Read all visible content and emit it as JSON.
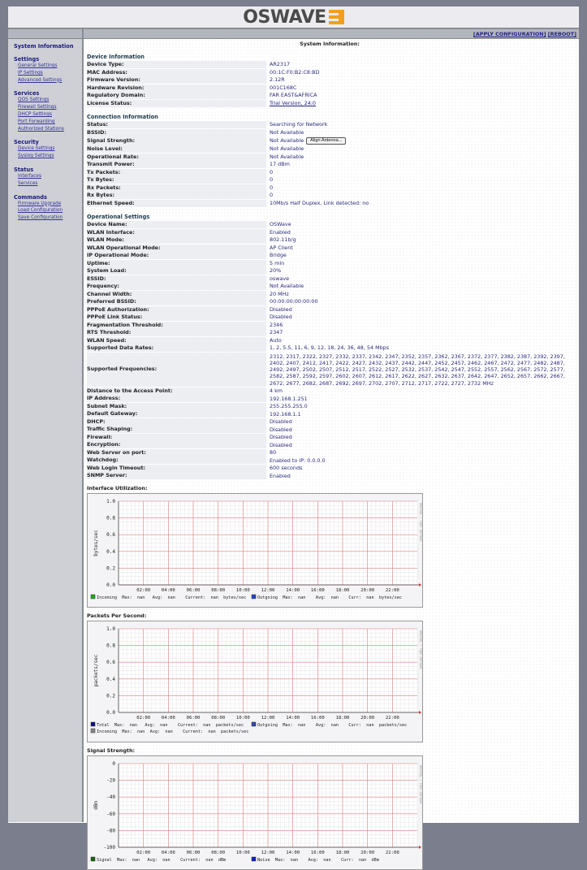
{
  "header": {
    "logo_text": "OSWAVE"
  },
  "topbar": {
    "apply": "[APPLY CONFIGURATION]",
    "reboot": "[REBOOT]"
  },
  "sidebar": {
    "system_info": "System Information",
    "sections": [
      {
        "title": "Settings",
        "links": [
          "General Settings",
          "IP Settings",
          "Advanced Settings"
        ]
      },
      {
        "title": "Services",
        "links": [
          "QOS Settings",
          "Firewall Settings",
          "DHCP Settings",
          "Port Forwarding",
          "Authorized Stations"
        ]
      },
      {
        "title": "Security",
        "links": [
          "Device Settings",
          "Syslog Settings"
        ]
      },
      {
        "title": "Status",
        "links": [
          "Interfaces",
          "Services"
        ]
      },
      {
        "title": "Commands",
        "links": [
          "Firmware Upgrade",
          "Load Configuration",
          "Save Configuration"
        ]
      }
    ]
  },
  "page_title": "System Information:",
  "device_info": {
    "title": "Device Information",
    "rows": [
      [
        "Device Type:",
        "AR2317"
      ],
      [
        "MAC Address:",
        "00:1C:F0:B2:C8:BD"
      ],
      [
        "Firmware Version:",
        "2.12R"
      ],
      [
        "Hardware Revision:",
        "001C168C"
      ],
      [
        "Regulatory Domain:",
        "FAR EAST&AFRICA"
      ],
      [
        "License Status:",
        "Trial Version, 24:0"
      ]
    ]
  },
  "connection_info": {
    "title": "Connection Information",
    "align_button": "Align Antenna...",
    "rows": [
      [
        "Status:",
        "Searching for Network"
      ],
      [
        "BSSID:",
        "Not Available"
      ],
      [
        "Signal Strength:",
        "Not Available"
      ],
      [
        "Noise Level:",
        "Not Available"
      ],
      [
        "Operational Rate:",
        "Not Available"
      ],
      [
        "Transmit Power:",
        "17 dBm"
      ],
      [
        "Tx Packets:",
        "0"
      ],
      [
        "Tx Bytes:",
        "0"
      ],
      [
        "Rx Packets:",
        "0"
      ],
      [
        "Rx Bytes:",
        "0"
      ],
      [
        "Ethernet Speed:",
        "10Mb/s Half Duplex, Link detected: no"
      ]
    ]
  },
  "operational": {
    "title": "Operational Settings",
    "rows": [
      [
        "Device Name:",
        "OSWave"
      ],
      [
        "WLAN Interface:",
        "Enabled"
      ],
      [
        "WLAN Mode:",
        "802.11b/g"
      ],
      [
        "WLAN Operational Mode:",
        "AP Client"
      ],
      [
        "IP Operational Mode:",
        "Bridge"
      ],
      [
        "Uptime:",
        "5 min"
      ],
      [
        "System Load:",
        "20%"
      ],
      [
        "ESSID:",
        "oswave"
      ],
      [
        "Frequency:",
        "Not Available"
      ],
      [
        "Channel Width:",
        "20 MHz"
      ],
      [
        "Preferred BSSID:",
        "00:00:00:00:00:00"
      ],
      [
        "PPPoE Authorization:",
        "Disabled"
      ],
      [
        "PPPoE Link Status:",
        "Disabled"
      ],
      [
        "Fragmentation Threshold:",
        "2346"
      ],
      [
        "RTS Threshold:",
        "2347"
      ],
      [
        "WLAN Speed:",
        "Auto"
      ],
      [
        "Supported Data Rates:",
        "1, 2, 5.5, 11, 6, 9, 12, 18, 24, 36, 48, 54 Mbps"
      ],
      [
        "Supported Frequencies:",
        "2312, 2317, 2322, 2327, 2332, 2337, 2342, 2347, 2352, 2357, 2362, 2367, 2372, 2377, 2382, 2387, 2392, 2397, 2402, 2407, 2412, 2417, 2422, 2427, 2432, 2437, 2442, 2447, 2452, 2457, 2462, 2467, 2472, 2477, 2482, 2487, 2492, 2497, 2502, 2507, 2512, 2517, 2522, 2527, 2532, 2537, 2542, 2547, 2552, 2557, 2562, 2567, 2572, 2577, 2582, 2587, 2592, 2597, 2602, 2607, 2612, 2617, 2622, 2627, 2632, 2637, 2642, 2647, 2652, 2657, 2662, 2667, 2672, 2677, 2682, 2687, 2692, 2697, 2702, 2707, 2712, 2717, 2722, 2727, 2732 MHz"
      ],
      [
        "Distance to the Access Point:",
        "4 km"
      ],
      [
        "IP Address:",
        "192.168.1.251"
      ],
      [
        "Subnet Mask:",
        "255.255.255.0"
      ],
      [
        "Default Gateway:",
        "192.168.1.1"
      ],
      [
        "DHCP:",
        "Disabled"
      ],
      [
        "Traffic Shaping:",
        "Disabled"
      ],
      [
        "Firewall:",
        "Disabled"
      ],
      [
        "Encryption:",
        "Disabled"
      ],
      [
        "Web Server on port:",
        "80"
      ],
      [
        "Watchdog:",
        "Enabled to IP: 0.0.0.0"
      ],
      [
        "Web Login Timeout:",
        "600 seconds"
      ],
      [
        "SNMP Server:",
        "Enabled"
      ]
    ]
  },
  "chart_data": [
    {
      "type": "line",
      "title": "Interface Utilization:",
      "ylabel": "bytes/sec",
      "ylim": [
        0,
        1.0
      ],
      "yticks": [
        "0.0",
        "0.2",
        "0.4",
        "0.6",
        "0.8",
        "1.0"
      ],
      "ytick_values": [
        0,
        0.2,
        0.4,
        0.6,
        0.8,
        1.0
      ],
      "xticks": [
        "02:00",
        "04:00",
        "06:00",
        "08:00",
        "10:00",
        "12:00",
        "14:00",
        "16:00",
        "18:00",
        "20:00",
        "22:00"
      ],
      "watermark": "RRDTOOL / TOBI OETIKER",
      "grid": true,
      "legend": [
        [
          {
            "color": "#22aa22",
            "text": "Incoming  Max:  nan   Avg:  nan    Current:  nan  bytes/sec"
          },
          {
            "color": "#2244cc",
            "text": "Outgoing  Max:  nan    Avg:  nan    Curr:  nan  bytes/sec"
          }
        ]
      ],
      "series": [
        {
          "name": "Incoming",
          "values": []
        },
        {
          "name": "Outgoing",
          "values": []
        }
      ]
    },
    {
      "type": "line",
      "title": "Packets Per Second:",
      "ylabel": "packets/sec",
      "ylim": [
        0,
        1.0
      ],
      "yticks": [
        "0.0",
        "0.2",
        "0.4",
        "0.6",
        "0.8",
        "1.0"
      ],
      "ytick_values": [
        0,
        0.2,
        0.4,
        0.6,
        0.8,
        1.0
      ],
      "xticks": [
        "02:00",
        "04:00",
        "06:00",
        "08:00",
        "10:00",
        "12:00",
        "14:00",
        "16:00",
        "18:00",
        "20:00",
        "22:00"
      ],
      "watermark": "RRDTOOL / TOBI OETIKER",
      "grid": true,
      "legend": [
        [
          {
            "color": "#101080",
            "text": "Total  Max:  nan   Avg:  nan    Current:  nan  packets/sec"
          },
          {
            "color": "#3344aa",
            "text": "Outgoing  Max:  nan    Avg:  nan    Curr:  nan  packets/sec"
          }
        ],
        [
          {
            "color": "#888888",
            "text": "Incoming  Max:  nan  Avg:  nan    Current:  nan  packets/sec"
          }
        ]
      ],
      "series": [
        {
          "name": "Total",
          "values": []
        },
        {
          "name": "Outgoing",
          "values": []
        },
        {
          "name": "Incoming",
          "values": []
        }
      ]
    },
    {
      "type": "line",
      "title": "Signal Strength:",
      "ylabel": "dBm",
      "ylim": [
        -100,
        0
      ],
      "yticks": [
        "-100",
        "-80",
        "-60",
        "-40",
        "-20",
        "0"
      ],
      "ytick_values": [
        -100,
        -80,
        -60,
        -40,
        -20,
        0
      ],
      "xticks": [
        "02:00",
        "04:00",
        "06:00",
        "08:00",
        "10:00",
        "12:00",
        "14:00",
        "16:00",
        "18:00",
        "20:00",
        "22:00"
      ],
      "watermark": "RRDTOOL / TOBI OETIKER",
      "grid": true,
      "legend": [
        [
          {
            "color": "#116611",
            "text": "Signal  Max:  nan   Avg:  nan    Current:  nan  dBm"
          },
          {
            "color": "#1122cc",
            "text": "Noise  Max:  nan    Avg:  nan    Curr:  nan  dBm"
          }
        ]
      ],
      "series": [
        {
          "name": "Signal",
          "values": []
        },
        {
          "name": "Noise",
          "values": []
        }
      ]
    }
  ]
}
